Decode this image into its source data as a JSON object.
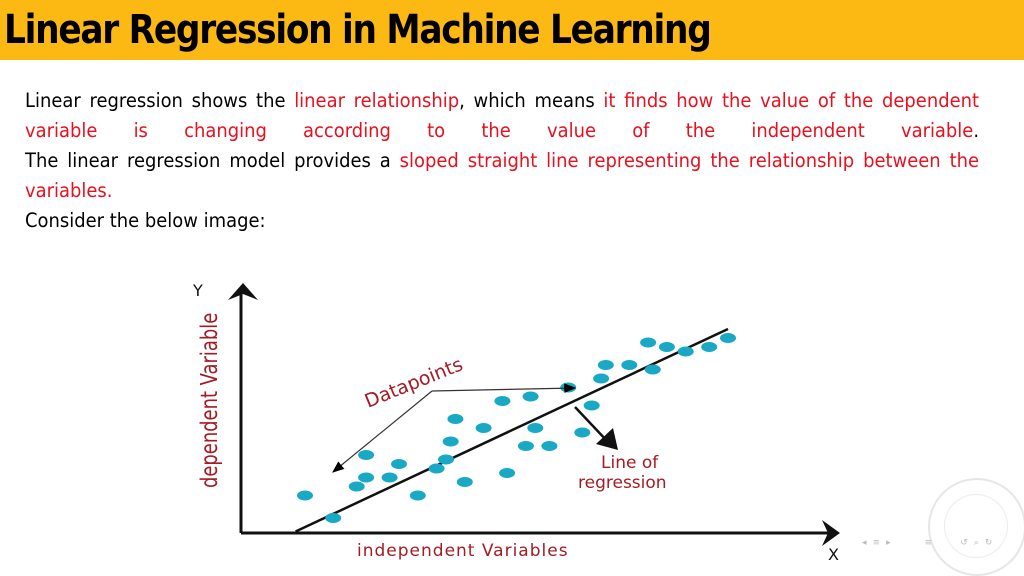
{
  "slide": {
    "title": "Linear Regression in Machine Learning",
    "colors": {
      "title_bar": "#FDB913",
      "highlight": "#e8101e",
      "diagram_label": "#a31c23",
      "datapoint": "#1aa9c4"
    },
    "paragraph1": {
      "segments": [
        {
          "text": "Linear regression shows the ",
          "highlight": false
        },
        {
          "text": "linear relationship",
          "highlight": true
        },
        {
          "text": ", which means ",
          "highlight": false
        },
        {
          "text": "it finds how the value of the dependent variable is changing according to the value of the independent variable",
          "highlight": true
        },
        {
          "text": ".",
          "highlight": false
        }
      ]
    },
    "paragraph2": {
      "segments": [
        {
          "text": "The linear regression model provides a ",
          "highlight": false
        },
        {
          "text": "sloped straight line representing the relationship between the variables.",
          "highlight": true
        }
      ]
    },
    "paragraph3": "Consider the below image:"
  },
  "diagram": {
    "y_axis_letter": "Y",
    "x_axis_letter": "X",
    "y_axis_label": "dependent Variable",
    "x_axis_label": "independent Variables",
    "datapoints_label": "Datapoints",
    "regression_label_line1": "Line of",
    "regression_label_line2": "regression",
    "points": [
      [
        1.0,
        1.1
      ],
      [
        1.6,
        0.6
      ],
      [
        2.1,
        1.3
      ],
      [
        2.3,
        2.0
      ],
      [
        2.3,
        1.5
      ],
      [
        2.8,
        1.5
      ],
      [
        3.4,
        1.1
      ],
      [
        3.0,
        1.8
      ],
      [
        3.8,
        1.7
      ],
      [
        4.1,
        2.3
      ],
      [
        4.0,
        1.9
      ],
      [
        4.2,
        2.8
      ],
      [
        4.4,
        1.4
      ],
      [
        5.3,
        1.6
      ],
      [
        4.8,
        2.6
      ],
      [
        5.2,
        3.2
      ],
      [
        5.8,
        3.3
      ],
      [
        5.9,
        2.6
      ],
      [
        6.2,
        2.2
      ],
      [
        6.6,
        3.5
      ],
      [
        7.3,
        3.7
      ],
      [
        7.4,
        4.0
      ],
      [
        7.9,
        4.0
      ],
      [
        8.4,
        3.9
      ],
      [
        8.7,
        4.4
      ],
      [
        8.3,
        4.5
      ],
      [
        9.1,
        4.3
      ],
      [
        9.6,
        4.4
      ],
      [
        10.0,
        4.6
      ],
      [
        7.1,
        3.1
      ],
      [
        6.9,
        2.5
      ],
      [
        5.7,
        2.2
      ]
    ],
    "regression_line": {
      "x": [
        0.8,
        10.0
      ],
      "y": [
        0.3,
        4.8
      ]
    }
  },
  "navigation": {
    "symbols": [
      "◂",
      "≡",
      "▸",
      "≡",
      "↺",
      "⌕",
      "↻"
    ]
  }
}
